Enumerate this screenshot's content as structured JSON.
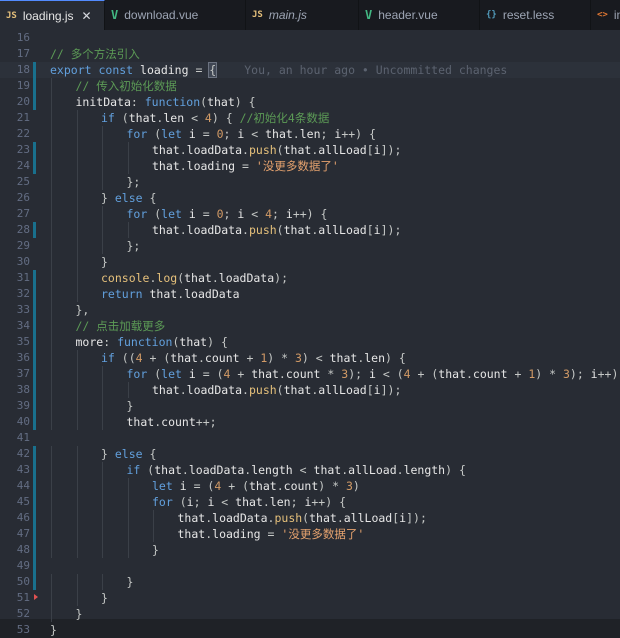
{
  "tabs": [
    {
      "icon": "JS",
      "label": "loading.js",
      "kind": "js",
      "active": true,
      "close": "✕"
    },
    {
      "icon": "V",
      "label": "download.vue",
      "kind": "vue"
    },
    {
      "icon": "JS",
      "label": "main.js",
      "kind": "js",
      "italic": true
    },
    {
      "icon": "V",
      "label": "header.vue",
      "kind": "vue"
    },
    {
      "icon": "{}",
      "label": "reset.less",
      "kind": "less"
    },
    {
      "icon": "<>",
      "label": "index.html",
      "kind": "html"
    },
    {
      "icon": "{}",
      "label": "",
      "kind": "less"
    }
  ],
  "blame": "You, an hour ago • Uncommitted changes",
  "lines": [
    {
      "n": "16",
      "mark": false,
      "indent": 0,
      "tokens": []
    },
    {
      "n": "17",
      "mark": false,
      "indent": 0,
      "tokens": [
        [
          "c",
          "// 多个方法引入"
        ]
      ]
    },
    {
      "n": "18",
      "mark": true,
      "indent": 0,
      "cursor": true,
      "tokens": [
        [
          "k",
          "export"
        ],
        [
          "p",
          " "
        ],
        [
          "k",
          "const"
        ],
        [
          "p",
          " "
        ],
        [
          "v",
          "loading"
        ],
        [
          "p",
          " = "
        ],
        [
          "brace",
          "{"
        ]
      ]
    },
    {
      "n": "19",
      "mark": true,
      "indent": 1,
      "tokens": [
        [
          "c",
          "// 传入初始化数据"
        ]
      ]
    },
    {
      "n": "20",
      "mark": true,
      "indent": 1,
      "tokens": [
        [
          "v",
          "initData"
        ],
        [
          "p",
          ": "
        ],
        [
          "k",
          "function"
        ],
        [
          "p",
          "("
        ],
        [
          "v",
          "that"
        ],
        [
          "p",
          ") {"
        ]
      ]
    },
    {
      "n": "21",
      "mark": false,
      "indent": 2,
      "tokens": [
        [
          "k",
          "if"
        ],
        [
          "p",
          " ("
        ],
        [
          "v",
          "that"
        ],
        [
          "p",
          "."
        ],
        [
          "v",
          "len"
        ],
        [
          "p",
          " < "
        ],
        [
          "n",
          "4"
        ],
        [
          "p",
          ") { "
        ],
        [
          "c",
          "//初始化4条数据"
        ]
      ]
    },
    {
      "n": "22",
      "mark": false,
      "indent": 3,
      "tokens": [
        [
          "k",
          "for"
        ],
        [
          "p",
          " ("
        ],
        [
          "k",
          "let"
        ],
        [
          "p",
          " "
        ],
        [
          "v",
          "i"
        ],
        [
          "p",
          " = "
        ],
        [
          "n",
          "0"
        ],
        [
          "p",
          "; "
        ],
        [
          "v",
          "i"
        ],
        [
          "p",
          " < "
        ],
        [
          "v",
          "that"
        ],
        [
          "p",
          "."
        ],
        [
          "v",
          "len"
        ],
        [
          "p",
          "; "
        ],
        [
          "v",
          "i"
        ],
        [
          "p",
          "++) {"
        ]
      ]
    },
    {
      "n": "23",
      "mark": true,
      "indent": 4,
      "tokens": [
        [
          "v",
          "that"
        ],
        [
          "p",
          "."
        ],
        [
          "v",
          "loadData"
        ],
        [
          "p",
          "."
        ],
        [
          "f",
          "push"
        ],
        [
          "p",
          "("
        ],
        [
          "v",
          "that"
        ],
        [
          "p",
          "."
        ],
        [
          "v",
          "allLoad"
        ],
        [
          "p",
          "["
        ],
        [
          "v",
          "i"
        ],
        [
          "p",
          "]);"
        ]
      ]
    },
    {
      "n": "24",
      "mark": true,
      "indent": 4,
      "tokens": [
        [
          "v",
          "that"
        ],
        [
          "p",
          "."
        ],
        [
          "v",
          "loading"
        ],
        [
          "p",
          " = "
        ],
        [
          "s",
          "'没更多数据了'"
        ]
      ]
    },
    {
      "n": "25",
      "mark": false,
      "indent": 3,
      "tokens": [
        [
          "p",
          "};"
        ]
      ]
    },
    {
      "n": "26",
      "mark": false,
      "indent": 2,
      "tokens": [
        [
          "p",
          "} "
        ],
        [
          "k",
          "else"
        ],
        [
          "p",
          " {"
        ]
      ]
    },
    {
      "n": "27",
      "mark": false,
      "indent": 3,
      "tokens": [
        [
          "k",
          "for"
        ],
        [
          "p",
          " ("
        ],
        [
          "k",
          "let"
        ],
        [
          "p",
          " "
        ],
        [
          "v",
          "i"
        ],
        [
          "p",
          " = "
        ],
        [
          "n",
          "0"
        ],
        [
          "p",
          "; "
        ],
        [
          "v",
          "i"
        ],
        [
          "p",
          " < "
        ],
        [
          "n",
          "4"
        ],
        [
          "p",
          "; "
        ],
        [
          "v",
          "i"
        ],
        [
          "p",
          "++) {"
        ]
      ]
    },
    {
      "n": "28",
      "mark": true,
      "indent": 4,
      "tokens": [
        [
          "v",
          "that"
        ],
        [
          "p",
          "."
        ],
        [
          "v",
          "loadData"
        ],
        [
          "p",
          "."
        ],
        [
          "f",
          "push"
        ],
        [
          "p",
          "("
        ],
        [
          "v",
          "that"
        ],
        [
          "p",
          "."
        ],
        [
          "v",
          "allLoad"
        ],
        [
          "p",
          "["
        ],
        [
          "v",
          "i"
        ],
        [
          "p",
          "]);"
        ]
      ]
    },
    {
      "n": "29",
      "mark": false,
      "indent": 3,
      "tokens": [
        [
          "p",
          "};"
        ]
      ]
    },
    {
      "n": "30",
      "mark": false,
      "indent": 2,
      "tokens": [
        [
          "p",
          "}"
        ]
      ]
    },
    {
      "n": "31",
      "mark": true,
      "indent": 2,
      "tokens": [
        [
          "f",
          "console"
        ],
        [
          "p",
          "."
        ],
        [
          "f",
          "log"
        ],
        [
          "p",
          "("
        ],
        [
          "v",
          "that"
        ],
        [
          "p",
          "."
        ],
        [
          "v",
          "loadData"
        ],
        [
          "p",
          ");"
        ]
      ]
    },
    {
      "n": "32",
      "mark": true,
      "indent": 2,
      "tokens": [
        [
          "k",
          "return"
        ],
        [
          "p",
          " "
        ],
        [
          "v",
          "that"
        ],
        [
          "p",
          "."
        ],
        [
          "v",
          "loadData"
        ]
      ]
    },
    {
      "n": "33",
      "mark": true,
      "indent": 1,
      "tokens": [
        [
          "p",
          "},"
        ]
      ]
    },
    {
      "n": "34",
      "mark": true,
      "indent": 1,
      "tokens": [
        [
          "c",
          "// 点击加载更多"
        ]
      ]
    },
    {
      "n": "35",
      "mark": true,
      "indent": 1,
      "tokens": [
        [
          "v",
          "more"
        ],
        [
          "p",
          ": "
        ],
        [
          "k",
          "function"
        ],
        [
          "p",
          "("
        ],
        [
          "v",
          "that"
        ],
        [
          "p",
          ") {"
        ]
      ]
    },
    {
      "n": "36",
      "mark": true,
      "indent": 2,
      "tokens": [
        [
          "k",
          "if"
        ],
        [
          "p",
          " (("
        ],
        [
          "n",
          "4"
        ],
        [
          "p",
          " + ("
        ],
        [
          "v",
          "that"
        ],
        [
          "p",
          "."
        ],
        [
          "v",
          "count"
        ],
        [
          "p",
          " + "
        ],
        [
          "n",
          "1"
        ],
        [
          "p",
          ") * "
        ],
        [
          "n",
          "3"
        ],
        [
          "p",
          ") < "
        ],
        [
          "v",
          "that"
        ],
        [
          "p",
          "."
        ],
        [
          "v",
          "len"
        ],
        [
          "p",
          ") {"
        ]
      ]
    },
    {
      "n": "37",
      "mark": true,
      "indent": 3,
      "tokens": [
        [
          "k",
          "for"
        ],
        [
          "p",
          " ("
        ],
        [
          "k",
          "let"
        ],
        [
          "p",
          " "
        ],
        [
          "v",
          "i"
        ],
        [
          "p",
          " = ("
        ],
        [
          "n",
          "4"
        ],
        [
          "p",
          " + "
        ],
        [
          "v",
          "that"
        ],
        [
          "p",
          "."
        ],
        [
          "v",
          "count"
        ],
        [
          "p",
          " * "
        ],
        [
          "n",
          "3"
        ],
        [
          "p",
          "); "
        ],
        [
          "v",
          "i"
        ],
        [
          "p",
          " < ("
        ],
        [
          "n",
          "4"
        ],
        [
          "p",
          " + ("
        ],
        [
          "v",
          "that"
        ],
        [
          "p",
          "."
        ],
        [
          "v",
          "count"
        ],
        [
          "p",
          " + "
        ],
        [
          "n",
          "1"
        ],
        [
          "p",
          ") * "
        ],
        [
          "n",
          "3"
        ],
        [
          "p",
          "); "
        ],
        [
          "v",
          "i"
        ],
        [
          "p",
          "++) {"
        ]
      ]
    },
    {
      "n": "38",
      "mark": true,
      "indent": 4,
      "tokens": [
        [
          "v",
          "that"
        ],
        [
          "p",
          "."
        ],
        [
          "v",
          "loadData"
        ],
        [
          "p",
          "."
        ],
        [
          "f",
          "push"
        ],
        [
          "p",
          "("
        ],
        [
          "v",
          "that"
        ],
        [
          "p",
          "."
        ],
        [
          "v",
          "allLoad"
        ],
        [
          "p",
          "["
        ],
        [
          "v",
          "i"
        ],
        [
          "p",
          "]);"
        ]
      ]
    },
    {
      "n": "39",
      "mark": true,
      "indent": 3,
      "tokens": [
        [
          "p",
          "}"
        ]
      ]
    },
    {
      "n": "40",
      "mark": true,
      "indent": 3,
      "tokens": [
        [
          "v",
          "that"
        ],
        [
          "p",
          "."
        ],
        [
          "v",
          "count"
        ],
        [
          "p",
          "++;"
        ]
      ]
    },
    {
      "n": "41",
      "mark": false,
      "indent": 0,
      "tokens": []
    },
    {
      "n": "42",
      "mark": true,
      "indent": 2,
      "tokens": [
        [
          "p",
          "} "
        ],
        [
          "k",
          "else"
        ],
        [
          "p",
          " {"
        ]
      ]
    },
    {
      "n": "43",
      "mark": true,
      "indent": 3,
      "tokens": [
        [
          "k",
          "if"
        ],
        [
          "p",
          " ("
        ],
        [
          "v",
          "that"
        ],
        [
          "p",
          "."
        ],
        [
          "v",
          "loadData"
        ],
        [
          "p",
          "."
        ],
        [
          "v",
          "length"
        ],
        [
          "p",
          " < "
        ],
        [
          "v",
          "that"
        ],
        [
          "p",
          "."
        ],
        [
          "v",
          "allLoad"
        ],
        [
          "p",
          "."
        ],
        [
          "v",
          "length"
        ],
        [
          "p",
          ") {"
        ]
      ]
    },
    {
      "n": "44",
      "mark": true,
      "indent": 4,
      "tokens": [
        [
          "k",
          "let"
        ],
        [
          "p",
          " "
        ],
        [
          "v",
          "i"
        ],
        [
          "p",
          " = ("
        ],
        [
          "n",
          "4"
        ],
        [
          "p",
          " + ("
        ],
        [
          "v",
          "that"
        ],
        [
          "p",
          "."
        ],
        [
          "v",
          "count"
        ],
        [
          "p",
          ") * "
        ],
        [
          "n",
          "3"
        ],
        [
          "p",
          ")"
        ]
      ]
    },
    {
      "n": "45",
      "mark": true,
      "indent": 4,
      "tokens": [
        [
          "k",
          "for"
        ],
        [
          "p",
          " ("
        ],
        [
          "v",
          "i"
        ],
        [
          "p",
          "; "
        ],
        [
          "v",
          "i"
        ],
        [
          "p",
          " < "
        ],
        [
          "v",
          "that"
        ],
        [
          "p",
          "."
        ],
        [
          "v",
          "len"
        ],
        [
          "p",
          "; "
        ],
        [
          "v",
          "i"
        ],
        [
          "p",
          "++) {"
        ]
      ]
    },
    {
      "n": "46",
      "mark": true,
      "indent": 5,
      "tokens": [
        [
          "v",
          "that"
        ],
        [
          "p",
          "."
        ],
        [
          "v",
          "loadData"
        ],
        [
          "p",
          "."
        ],
        [
          "f",
          "push"
        ],
        [
          "p",
          "("
        ],
        [
          "v",
          "that"
        ],
        [
          "p",
          "."
        ],
        [
          "v",
          "allLoad"
        ],
        [
          "p",
          "["
        ],
        [
          "v",
          "i"
        ],
        [
          "p",
          "]);"
        ]
      ]
    },
    {
      "n": "47",
      "mark": true,
      "indent": 5,
      "tokens": [
        [
          "v",
          "that"
        ],
        [
          "p",
          "."
        ],
        [
          "v",
          "loading"
        ],
        [
          "p",
          " = "
        ],
        [
          "s",
          "'没更多数据了'"
        ]
      ]
    },
    {
      "n": "48",
      "mark": true,
      "indent": 4,
      "tokens": [
        [
          "p",
          "}"
        ]
      ]
    },
    {
      "n": "49",
      "mark": true,
      "indent": 0,
      "tokens": []
    },
    {
      "n": "50",
      "mark": true,
      "indent": 3,
      "tokens": [
        [
          "p",
          "}"
        ]
      ]
    },
    {
      "n": "51",
      "mark": false,
      "indent": 2,
      "redmark": true,
      "tokens": [
        [
          "p",
          "}"
        ]
      ]
    },
    {
      "n": "52",
      "mark": false,
      "indent": 1,
      "tokens": [
        [
          "p",
          "}"
        ]
      ]
    },
    {
      "n": "53",
      "mark": false,
      "indent": 0,
      "tokens": [
        [
          "p",
          "}"
        ]
      ]
    }
  ]
}
